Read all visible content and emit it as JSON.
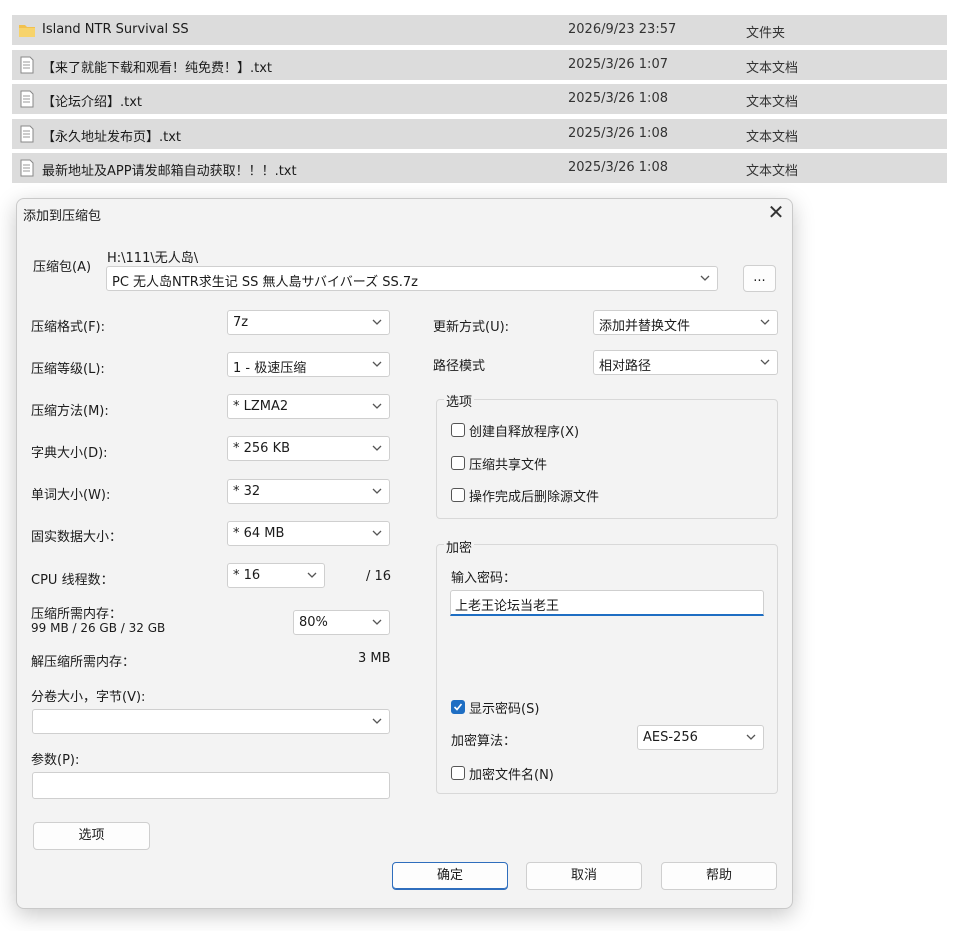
{
  "files": [
    {
      "name": "Island NTR Survival SS",
      "date": "2026/9/23 23:57",
      "type": "文件夹",
      "icon": "folder-icon"
    },
    {
      "name": "【来了就能下载和观看！纯免费！】.txt",
      "date": "2025/3/26 1:07",
      "type": "文本文档",
      "icon": "text-file-icon"
    },
    {
      "name": "【论坛介绍】.txt",
      "date": "2025/3/26 1:08",
      "type": "文本文档",
      "icon": "text-file-icon"
    },
    {
      "name": "【永久地址发布页】.txt",
      "date": "2025/3/26 1:08",
      "type": "文本文档",
      "icon": "text-file-icon"
    },
    {
      "name": "最新地址及APP请发邮箱自动获取！！！.txt",
      "date": "2025/3/26 1:08",
      "type": "文本文档",
      "icon": "text-file-icon"
    }
  ],
  "dialog": {
    "title": "添加到压缩包",
    "close": "✕",
    "archive": {
      "label": "压缩包(A)",
      "path": "H:\\111\\无人岛\\",
      "filename": "PC 无人岛NTR求生记 SS 無人島サバイバーズ SS.7z",
      "browse": "..."
    },
    "format": {
      "label": "压缩格式(F):",
      "value": "7z"
    },
    "level": {
      "label": "压缩等级(L):",
      "value": "1 - 极速压缩"
    },
    "method": {
      "label": "压缩方法(M):",
      "value": "* LZMA2"
    },
    "dict": {
      "label": "字典大小(D):",
      "value": "* 256 KB"
    },
    "word": {
      "label": "单词大小(W):",
      "value": "* 32"
    },
    "solid": {
      "label": "固实数据大小：",
      "value": "* 64 MB"
    },
    "threads": {
      "label": "CPU 线程数：",
      "value": "* 16",
      "max": "/ 16"
    },
    "memory": {
      "label": "压缩所需内存：",
      "detail": "99 MB / 26 GB / 32 GB",
      "value": "80%"
    },
    "decomp": {
      "label": "解压缩所需内存：",
      "value": "3 MB"
    },
    "volume": {
      "label": "分卷大小，字节(V):",
      "value": ""
    },
    "params": {
      "label": "参数(P):",
      "value": ""
    },
    "options_button": "选项",
    "update": {
      "label": "更新方式(U):",
      "value": "添加并替换文件"
    },
    "pathmode": {
      "label": "路径模式",
      "value": "相对路径"
    },
    "options_group": {
      "label": "选项",
      "sfx": {
        "label": "创建自释放程序(X)",
        "checked": false
      },
      "shared": {
        "label": "压缩共享文件",
        "checked": false
      },
      "delete": {
        "label": "操作完成后删除源文件",
        "checked": false
      }
    },
    "encryption": {
      "label": "加密",
      "password_label": "输入密码：",
      "password": "上老王论坛当老王",
      "show_password": {
        "label": "显示密码(S)",
        "checked": true
      },
      "method_label": "加密算法：",
      "method": "AES-256",
      "encrypt_names": {
        "label": "加密文件名(N)",
        "checked": false
      }
    },
    "ok": "确定",
    "cancel": "取消",
    "help": "帮助"
  },
  "colors": {
    "accent": "#1e6ec3",
    "row_bg": "#dcdcdc",
    "folder": "#f2c14e"
  }
}
